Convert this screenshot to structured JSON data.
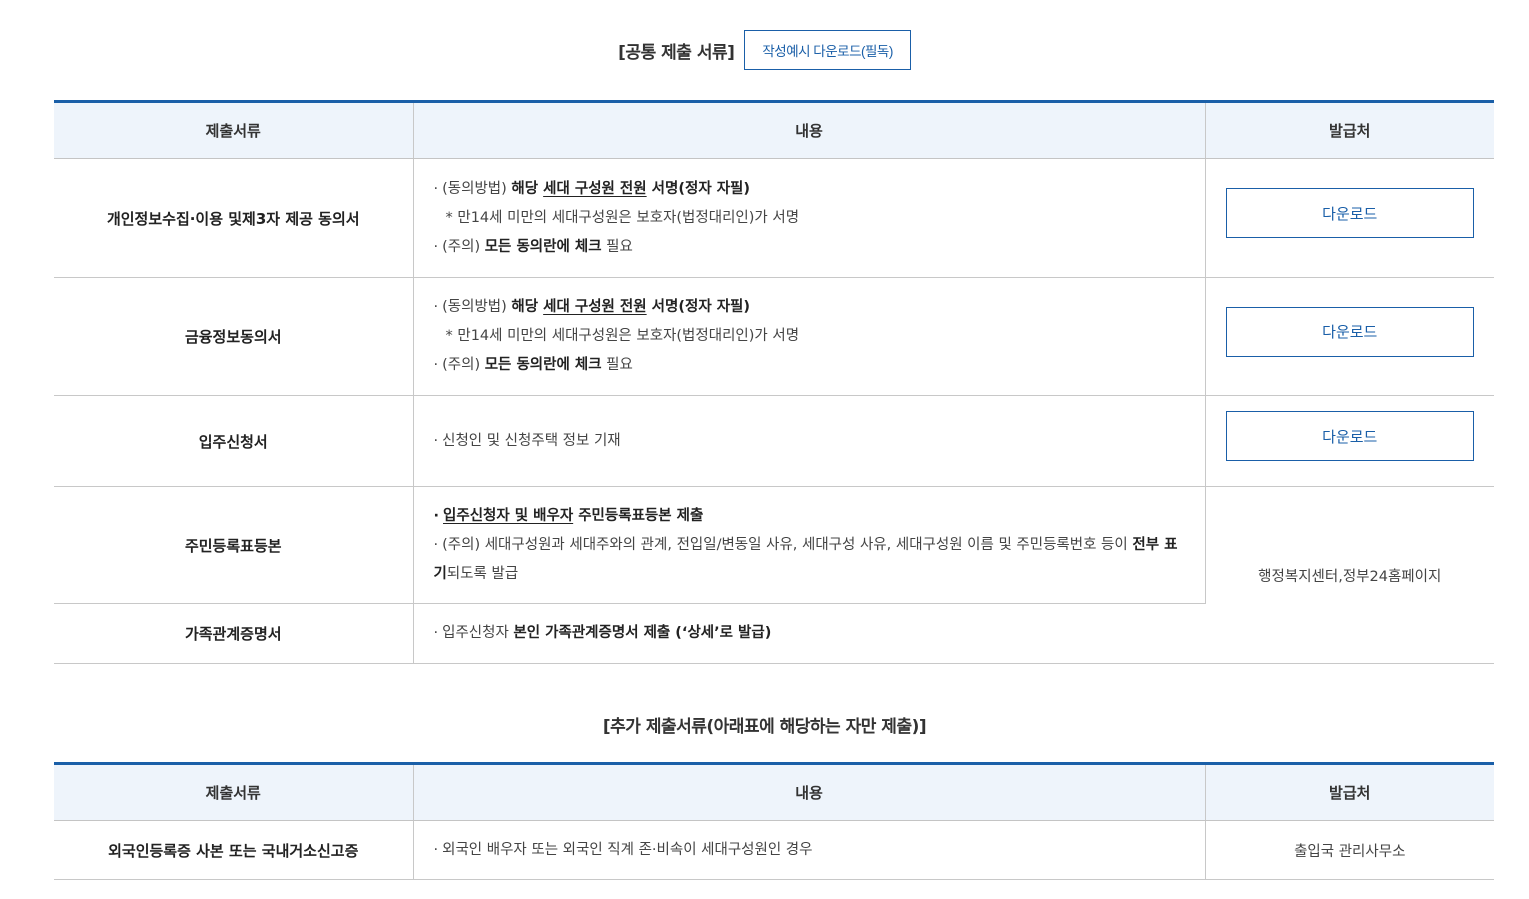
{
  "common": {
    "title": "[공통 제출 서류]",
    "sample_button": "작성예시 다운로드(필독)",
    "headers": [
      "제출서류",
      "내용",
      "발급처"
    ],
    "rows": {
      "r1": {
        "doc": "개인정보수집·이용 및제3자 제공 동의서",
        "l1_a": "(동의방법) ",
        "l1_b": "해당 ",
        "l1_u": "세대 구성원 전원",
        "l1_c": " 서명(정자 자필)",
        "l2": "* 만14세 미만의 세대구성원은 보호자(법정대리인)가 서명",
        "l3_a": "(주의) ",
        "l3_b": "모든 동의란에 체크",
        "l3_c": " 필요",
        "button": "다운로드"
      },
      "r2": {
        "doc": "금융정보동의서",
        "l1_a": "(동의방법) ",
        "l1_b": "해당 ",
        "l1_u": "세대 구성원 전원",
        "l1_c": " 서명(정자 자필)",
        "l2": "* 만14세 미만의 세대구성원은 보호자(법정대리인)가 서명",
        "l3_a": "(주의) ",
        "l3_b": "모든 동의란에 체크",
        "l3_c": " 필요",
        "button": "다운로드"
      },
      "r3": {
        "doc": "입주신청서",
        "l1": "신청인 및 신청주택 정보 기재",
        "button": "다운로드"
      },
      "r4": {
        "doc": "주민등록표등본",
        "l1_u": "입주신청자 및 배우자",
        "l1_b": " 주민등록표등본 제출",
        "l2_a": "(주의) 세대구성원과 세대주와의 관계, 전입일/변동일 사유, 세대구성 사유, 세대구성원 이름 및 주민등록번호 등이 ",
        "l2_b": "전부 표기",
        "l2_c": "되도록 발급"
      },
      "r5": {
        "doc": "가족관계증명서",
        "l1_a": "입주신청자 ",
        "l1_b": "본인 가족관계증명서 제출 (‘상세’로 발급)"
      },
      "shared_issuer": "행정복지센터,정부24홈페이지"
    }
  },
  "additional": {
    "title": "[추가 제출서류(아래표에 해당하는 자만 제출)]",
    "headers": [
      "제출서류",
      "내용",
      "발급처"
    ],
    "rows": {
      "r1": {
        "doc": "외국인등록증 사본 또는 국내거소신고증",
        "l1": "외국인 배우자 또는 외국인 직계 존·비속이 세대구성원인 경우",
        "issuer": "출입국 관리사무소"
      }
    }
  },
  "bullet": "·",
  "colors": {
    "accent": "#1a5fa8",
    "header_bg": "#eef4fb"
  }
}
